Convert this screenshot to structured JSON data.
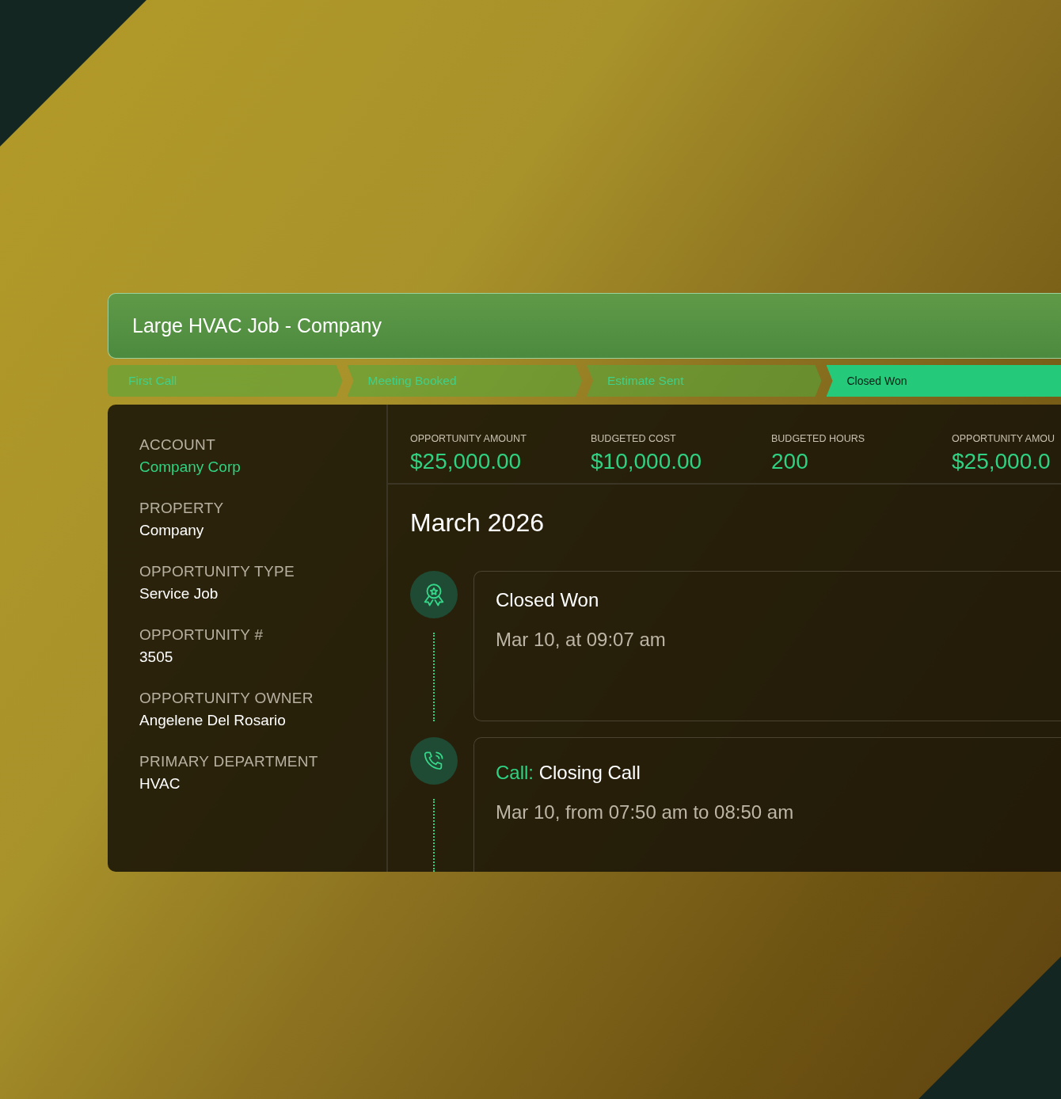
{
  "title": "Large HVAC Job - Company",
  "stages": [
    {
      "label": "First Call",
      "selected": false
    },
    {
      "label": "Meeting Booked",
      "selected": false
    },
    {
      "label": "Estimate Sent",
      "selected": false
    },
    {
      "label": "Closed Won",
      "selected": true
    }
  ],
  "details": [
    {
      "label": "ACCOUNT",
      "value": "Company Corp",
      "link": true
    },
    {
      "label": "PROPERTY",
      "value": "Company",
      "link": false
    },
    {
      "label": "OPPORTUNITY TYPE",
      "value": "Service Job",
      "link": false
    },
    {
      "label": "OPPORTUNITY #",
      "value": "3505",
      "link": false
    },
    {
      "label": "OPPORTUNITY OWNER",
      "value": "Angelene Del Rosario",
      "link": false
    },
    {
      "label": "PRIMARY DEPARTMENT",
      "value": "HVAC",
      "link": false
    }
  ],
  "stats": [
    {
      "label": "OPPORTUNITY AMOUNT",
      "value": "$25,000.00"
    },
    {
      "label": "BUDGETED COST",
      "value": "$10,000.00"
    },
    {
      "label": "BUDGETED HOURS",
      "value": "200"
    },
    {
      "label": "OPPORTUNITY AMOU",
      "value": "$25,000.0"
    }
  ],
  "timeline": {
    "month": "March 2026",
    "events": [
      {
        "kind": "award",
        "title": "Closed Won",
        "time": "Mar 10, at 09:07 am"
      },
      {
        "kind": "call",
        "type_label": "Call:",
        "title": "Closing Call",
        "time": "Mar 10, from 07:50 am to 08:50 am"
      }
    ]
  }
}
